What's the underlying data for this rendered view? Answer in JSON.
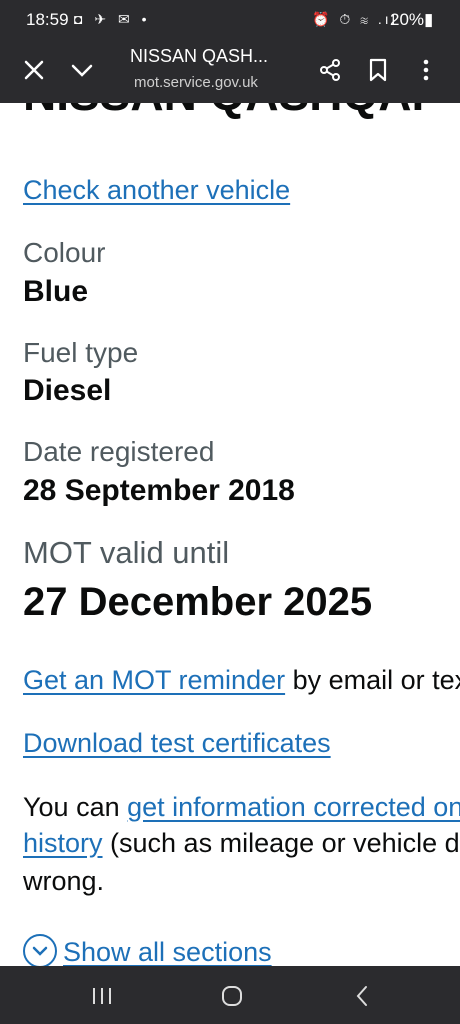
{
  "status_bar": {
    "time": "18:59",
    "left_icons": "◘ ✈ ✉ •",
    "right_icons": "⏰ ⏱ ≋ .ıl",
    "battery": "20%▮"
  },
  "toolbar": {
    "title": "NISSAN QASH...",
    "url": "mot.service.gov.uk"
  },
  "page": {
    "heading_clipped": "NISSAN QASHQAI",
    "check_link": "Check another vehicle",
    "colour_label": "Colour",
    "colour_value": "Blue",
    "fuel_label": "Fuel type",
    "fuel_value": "Diesel",
    "registered_label": "Date registered",
    "registered_value": "28 September 2018",
    "mot_label": "MOT valid until",
    "mot_value": "27 December 2025",
    "reminder_link": "Get an MOT reminder",
    "reminder_rest": " by email or text",
    "download_link": "Download test certificates",
    "info_prefix": "You can ",
    "info_link_1": "get information corrected on your MOT",
    "info_link_2": "history",
    "info_rest": " (such as mileage or vehicle details) if it's",
    "info_end": "wrong.",
    "show_all": "Show all sections"
  },
  "colors": {
    "link": "#1d70b8",
    "text": "#0b0c0c",
    "secondary": "#505a5f",
    "chrome": "#2b2b2e"
  }
}
